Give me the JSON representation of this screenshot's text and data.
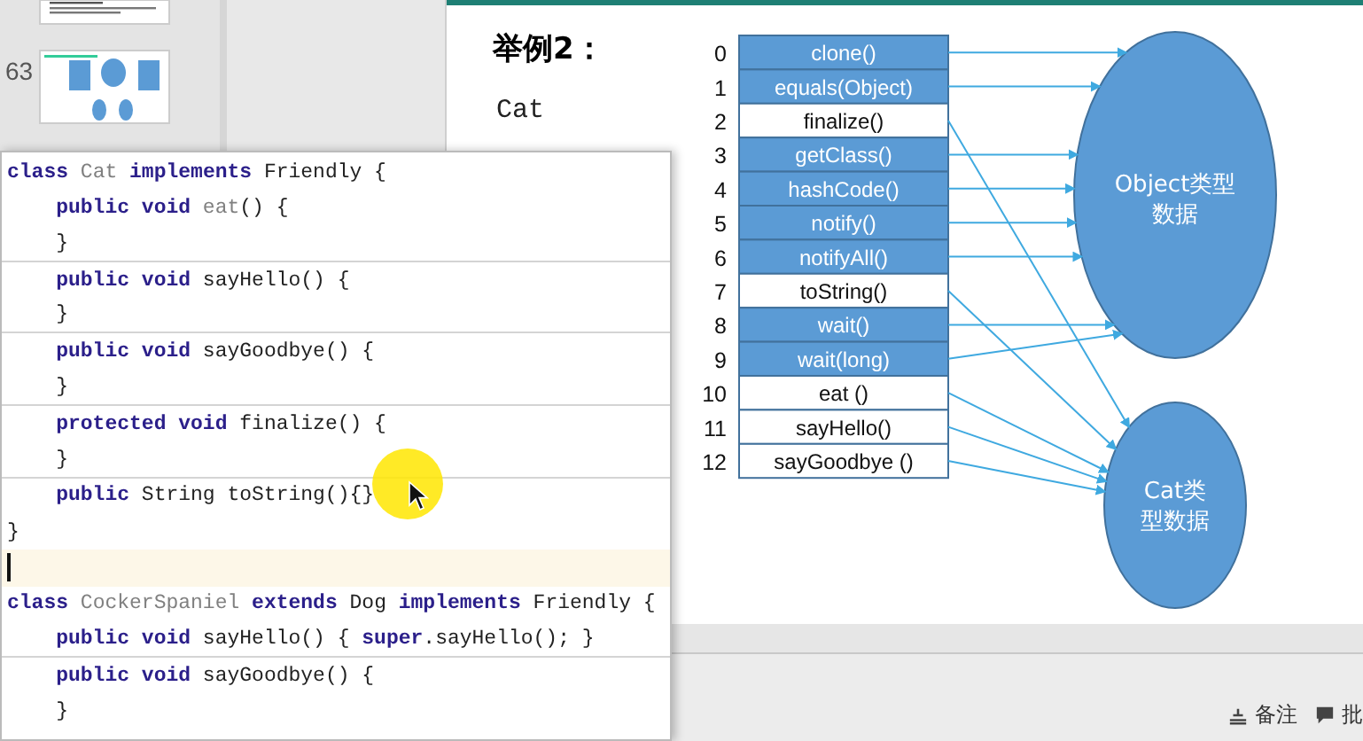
{
  "sidebar": {
    "thumbnails": [
      {
        "kind": "text-slide"
      },
      {
        "kind": "diagram-slide",
        "number": "63"
      }
    ]
  },
  "slide": {
    "title": "举例2：",
    "subtitle": "Cat",
    "methods": [
      {
        "index": "0",
        "label": "clone()",
        "filled": true,
        "kind": "object"
      },
      {
        "index": "1",
        "label": "equals(Object)",
        "filled": true,
        "kind": "object"
      },
      {
        "index": "2",
        "label": "finalize()",
        "filled": false,
        "kind": "cat"
      },
      {
        "index": "3",
        "label": "getClass()",
        "filled": true,
        "kind": "object"
      },
      {
        "index": "4",
        "label": "hashCode()",
        "filled": true,
        "kind": "object"
      },
      {
        "index": "5",
        "label": "notify()",
        "filled": true,
        "kind": "object"
      },
      {
        "index": "6",
        "label": "notifyAll()",
        "filled": true,
        "kind": "object"
      },
      {
        "index": "7",
        "label": "toString()",
        "filled": false,
        "kind": "cat"
      },
      {
        "index": "8",
        "label": "wait()",
        "filled": true,
        "kind": "object"
      },
      {
        "index": "9",
        "label": "wait(long)",
        "filled": true,
        "kind": "object"
      },
      {
        "index": "10",
        "label": "eat ()",
        "filled": false,
        "kind": "cat"
      },
      {
        "index": "11",
        "label": "sayHello()",
        "filled": false,
        "kind": "cat"
      },
      {
        "index": "12",
        "label": "sayGoodbye ()",
        "filled": false,
        "kind": "cat"
      }
    ],
    "object_label": [
      "Object类型",
      "数据"
    ],
    "cat_label": [
      "Cat类",
      "型数据"
    ]
  },
  "editor": {
    "lines": [
      {
        "segments": [
          {
            "text": "class",
            "kind": "keyword"
          },
          {
            "text": " Cat ",
            "kind": "dim"
          },
          {
            "text": "implements",
            "kind": "keyword"
          },
          {
            "text": " Friendly {",
            "kind": "plain"
          }
        ],
        "divider": false,
        "current": false
      },
      {
        "segments": [
          {
            "text": "    public void",
            "kind": "keyword"
          },
          {
            "text": " eat",
            "kind": "dim"
          },
          {
            "text": "() {",
            "kind": "plain"
          }
        ],
        "divider": false,
        "current": false
      },
      {
        "segments": [
          {
            "text": "    }",
            "kind": "plain"
          }
        ],
        "divider": true,
        "current": false
      },
      {
        "segments": [
          {
            "text": "    public void",
            "kind": "keyword"
          },
          {
            "text": " sayHello() {",
            "kind": "plain"
          }
        ],
        "divider": false,
        "current": false
      },
      {
        "segments": [
          {
            "text": "    }",
            "kind": "plain"
          }
        ],
        "divider": true,
        "current": false
      },
      {
        "segments": [
          {
            "text": "    public void",
            "kind": "keyword"
          },
          {
            "text": " sayGoodbye() {",
            "kind": "plain"
          }
        ],
        "divider": false,
        "current": false
      },
      {
        "segments": [
          {
            "text": "    }",
            "kind": "plain"
          }
        ],
        "divider": true,
        "current": false
      },
      {
        "segments": [
          {
            "text": "    protected void",
            "kind": "keyword"
          },
          {
            "text": " finalize() {",
            "kind": "plain"
          }
        ],
        "divider": false,
        "current": false
      },
      {
        "segments": [
          {
            "text": "    }",
            "kind": "plain"
          }
        ],
        "divider": true,
        "current": false
      },
      {
        "segments": [
          {
            "text": "    public",
            "kind": "keyword"
          },
          {
            "text": " String toString(){}",
            "kind": "plain"
          }
        ],
        "divider": false,
        "current": false
      },
      {
        "segments": [
          {
            "text": "}",
            "kind": "plain"
          }
        ],
        "divider": false,
        "current": false
      },
      {
        "divider": false,
        "current": true
      },
      {
        "segments": [
          {
            "text": "class",
            "kind": "keyword"
          },
          {
            "text": " CockerSpaniel ",
            "kind": "dim"
          },
          {
            "text": "extends",
            "kind": "keyword"
          },
          {
            "text": " Dog ",
            "kind": "plain"
          },
          {
            "text": "implements",
            "kind": "keyword"
          },
          {
            "text": " Friendly {",
            "kind": "plain"
          }
        ],
        "divider": false,
        "current": false
      },
      {
        "segments": [
          {
            "text": "    public void",
            "kind": "keyword"
          },
          {
            "text": " sayHello() { ",
            "kind": "plain"
          },
          {
            "text": "super",
            "kind": "keyword"
          },
          {
            "text": ".sayHello(); }",
            "kind": "plain"
          }
        ],
        "divider": true,
        "current": false
      },
      {
        "segments": [
          {
            "text": "    public void",
            "kind": "keyword"
          },
          {
            "text": " sayGoodbye() {",
            "kind": "plain"
          }
        ],
        "divider": false,
        "current": false
      },
      {
        "segments": [
          {
            "text": "    }",
            "kind": "plain"
          }
        ],
        "divider": false,
        "current": false
      }
    ]
  },
  "status_bar": {
    "items": [
      {
        "label": "备注",
        "kind": "notes"
      },
      {
        "label": "批",
        "kind": "comments"
      }
    ]
  }
}
